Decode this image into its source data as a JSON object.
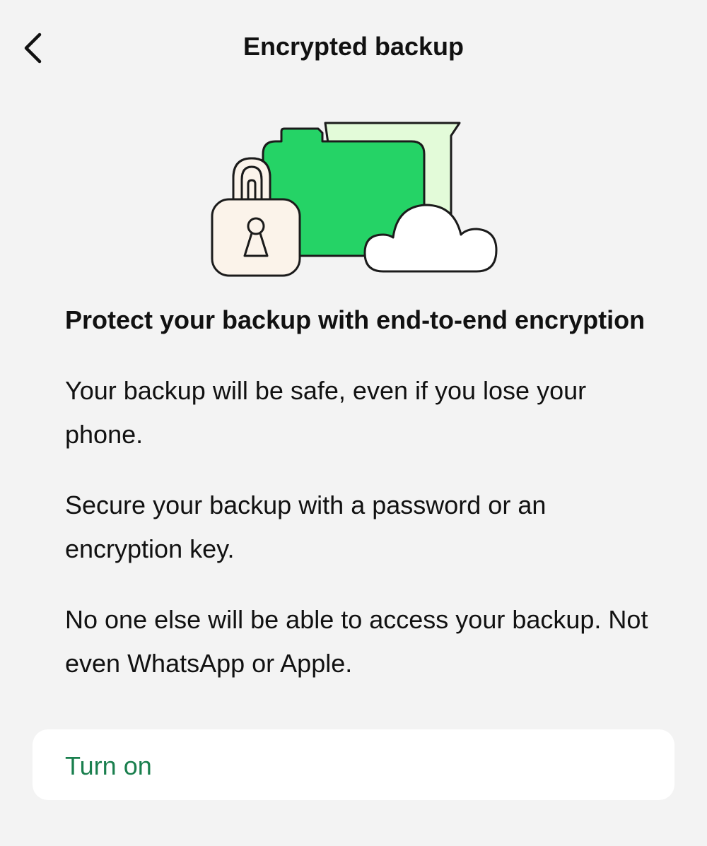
{
  "nav": {
    "back_icon": "chevron-left-icon",
    "title": "Encrypted backup"
  },
  "illustration": {
    "icons": [
      "padlock-icon",
      "folder-icon",
      "cloud-icon"
    ],
    "colors": {
      "folder_green": "#25d366",
      "folder_back_light_green": "#e3fbd9",
      "lock_body": "#fbf3ea",
      "cloud": "#ffffff",
      "outline": "#1b1b1b"
    }
  },
  "content": {
    "headline": "Protect your backup with end-to-end encryption",
    "paragraphs": [
      "Your backup will be safe, even if you lose your phone.",
      "Secure your backup with a password or an encryption key.",
      "No one else will be able to access your backup. Not even WhatsApp or Apple."
    ]
  },
  "action": {
    "turn_on_label": "Turn on",
    "accent_color": "#1a7f4e"
  },
  "theme": {
    "background": "#f3f3f3",
    "text": "#111111"
  }
}
